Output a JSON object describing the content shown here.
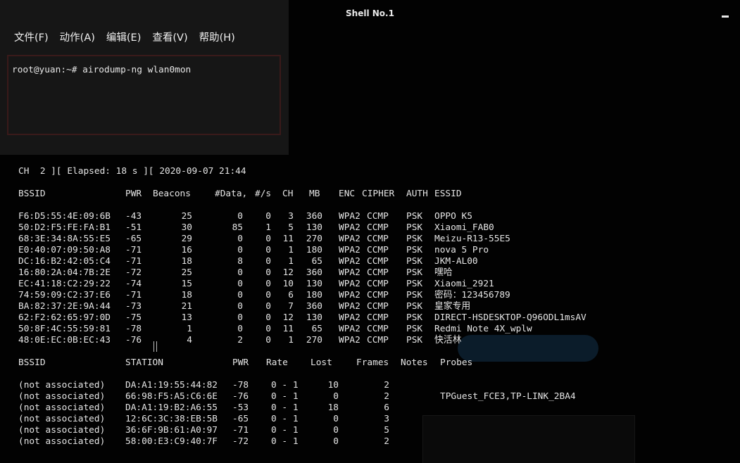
{
  "window": {
    "title": "Shell No.1"
  },
  "menu": [
    "文件(F)",
    "动作(A)",
    "编辑(E)",
    "查看(V)",
    "帮助(H)"
  ],
  "prompt": {
    "user_host": "root@yuan:~#",
    "command": "airodump-ng wlan0mon"
  },
  "status_line": "CH  2 ][ Elapsed: 18 s ][ 2020-09-07 21:44",
  "ap_headers": [
    "BSSID",
    "PWR",
    "Beacons",
    "#Data,",
    "#/s",
    "CH",
    "MB",
    "ENC",
    "CIPHER",
    "AUTH",
    "ESSID"
  ],
  "access_points": [
    {
      "bssid": "F6:D5:55:4E:09:6B",
      "pwr": "-43",
      "beacons": "25",
      "data": "0",
      "rate": "0",
      "ch": "3",
      "mb": "360",
      "enc": "WPA2",
      "cipher": "CCMP",
      "auth": "PSK",
      "essid": "OPPO K5"
    },
    {
      "bssid": "50:D2:F5:FE:FA:B1",
      "pwr": "-51",
      "beacons": "30",
      "data": "85",
      "rate": "1",
      "ch": "5",
      "mb": "130",
      "enc": "WPA2",
      "cipher": "CCMP",
      "auth": "PSK",
      "essid": "Xiaomi_FAB0"
    },
    {
      "bssid": "68:3E:34:8A:55:E5",
      "pwr": "-65",
      "beacons": "29",
      "data": "0",
      "rate": "0",
      "ch": "11",
      "mb": "270",
      "enc": "WPA2",
      "cipher": "CCMP",
      "auth": "PSK",
      "essid": "Meizu-R13-55E5"
    },
    {
      "bssid": "E0:40:07:09:50:A8",
      "pwr": "-71",
      "beacons": "16",
      "data": "0",
      "rate": "0",
      "ch": "1",
      "mb": "180",
      "enc": "WPA2",
      "cipher": "CCMP",
      "auth": "PSK",
      "essid": "nova 5 Pro"
    },
    {
      "bssid": "DC:16:B2:42:05:C4",
      "pwr": "-71",
      "beacons": "18",
      "data": "8",
      "rate": "0",
      "ch": "1",
      "mb": "65",
      "enc": "WPA2",
      "cipher": "CCMP",
      "auth": "PSK",
      "essid": "JKM-AL00"
    },
    {
      "bssid": "16:80:2A:04:7B:2E",
      "pwr": "-72",
      "beacons": "25",
      "data": "0",
      "rate": "0",
      "ch": "12",
      "mb": "360",
      "enc": "WPA2",
      "cipher": "CCMP",
      "auth": "PSK",
      "essid": "嘿哈"
    },
    {
      "bssid": "EC:41:18:C2:29:22",
      "pwr": "-74",
      "beacons": "15",
      "data": "0",
      "rate": "0",
      "ch": "10",
      "mb": "130",
      "enc": "WPA2",
      "cipher": "CCMP",
      "auth": "PSK",
      "essid": "Xiaomi_2921"
    },
    {
      "bssid": "74:59:09:C2:37:E6",
      "pwr": "-71",
      "beacons": "18",
      "data": "0",
      "rate": "0",
      "ch": "6",
      "mb": "180",
      "enc": "WPA2",
      "cipher": "CCMP",
      "auth": "PSK",
      "essid": "密码：123456789"
    },
    {
      "bssid": "BA:82:37:2E:9A:44",
      "pwr": "-73",
      "beacons": "21",
      "data": "0",
      "rate": "0",
      "ch": "7",
      "mb": "360",
      "enc": "WPA2",
      "cipher": "CCMP",
      "auth": "PSK",
      "essid": "皇家专用"
    },
    {
      "bssid": "62:F2:62:65:97:0D",
      "pwr": "-75",
      "beacons": "13",
      "data": "0",
      "rate": "0",
      "ch": "12",
      "mb": "130",
      "enc": "WPA2",
      "cipher": "CCMP",
      "auth": "PSK",
      "essid": "DIRECT-HSDESKTOP-Q96ODL1msAV"
    },
    {
      "bssid": "50:8F:4C:55:59:81",
      "pwr": "-78",
      "beacons": "1",
      "data": "0",
      "rate": "0",
      "ch": "11",
      "mb": "65",
      "enc": "WPA2",
      "cipher": "CCMP",
      "auth": "PSK",
      "essid": "Redmi Note 4X_wplw"
    },
    {
      "bssid": "48:0E:EC:0B:EC:43",
      "pwr": "-76",
      "beacons": "4",
      "data": "2",
      "rate": "0",
      "ch": "1",
      "mb": "270",
      "enc": "WPA2",
      "cipher": "CCMP",
      "auth": "PSK",
      "essid": "快活林"
    }
  ],
  "station_headers": [
    "BSSID",
    "STATION",
    "PWR",
    "Rate",
    "Lost",
    "Frames",
    "Notes",
    "Probes"
  ],
  "stations": [
    {
      "bssid": "(not associated)",
      "station": "DA:A1:19:55:44:82",
      "pwr": "-78",
      "rate": "0 - 1",
      "lost": "10",
      "frames": "2"
    },
    {
      "bssid": "(not associated)",
      "station": "66:98:F5:A5:C6:6E",
      "pwr": "-76",
      "rate": "0 - 1",
      "lost": "0",
      "frames": "2"
    },
    {
      "bssid": "(not associated)",
      "station": "DA:A1:19:B2:A6:55",
      "pwr": "-53",
      "rate": "0 - 1",
      "lost": "18",
      "frames": "6"
    },
    {
      "bssid": "(not associated)",
      "station": "12:6C:3C:38:EB:5B",
      "pwr": "-65",
      "rate": "0 - 1",
      "lost": "0",
      "frames": "3"
    },
    {
      "bssid": "(not associated)",
      "station": "36:6F:9B:61:A0:97",
      "pwr": "-71",
      "rate": "0 - 1",
      "lost": "0",
      "frames": "5"
    },
    {
      "bssid": "(not associated)",
      "station": "58:00:E3:C9:40:7F",
      "pwr": "-72",
      "rate": "0 - 1",
      "lost": "0",
      "frames": "2"
    }
  ],
  "probes_extra": "TPGuest_FCE3,TP-LINK_2BA4"
}
